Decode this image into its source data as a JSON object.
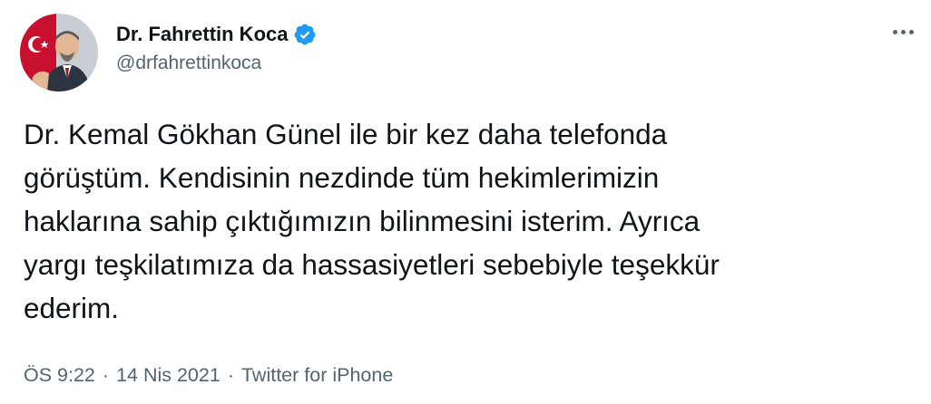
{
  "author": {
    "display_name": "Dr. Fahrettin Koca",
    "handle": "@drfahrettinkoca",
    "verified": true,
    "avatar_icon": "profile-photo"
  },
  "tweet": {
    "text": "Dr. Kemal Gökhan Günel ile bir kez daha telefonda\ngörüştüm. Kendisinin nezdinde tüm hekimlerimizin\nhaklarına sahip çıktığımızın bilinmesini isterim. Ayrıca\nyargı teşkilatımıza da hassasiyetleri sebebiyle teşekkür\nederim.",
    "time": "ÖS 9:22",
    "separator": "·",
    "date": "14 Nis 2021",
    "source": "Twitter for iPhone"
  },
  "icons": {
    "more": "more-options-icon",
    "verified": "verified-badge-icon"
  },
  "colors": {
    "text_primary": "#0f1419",
    "text_secondary": "#536471",
    "verified_blue": "#1d9bf0"
  }
}
